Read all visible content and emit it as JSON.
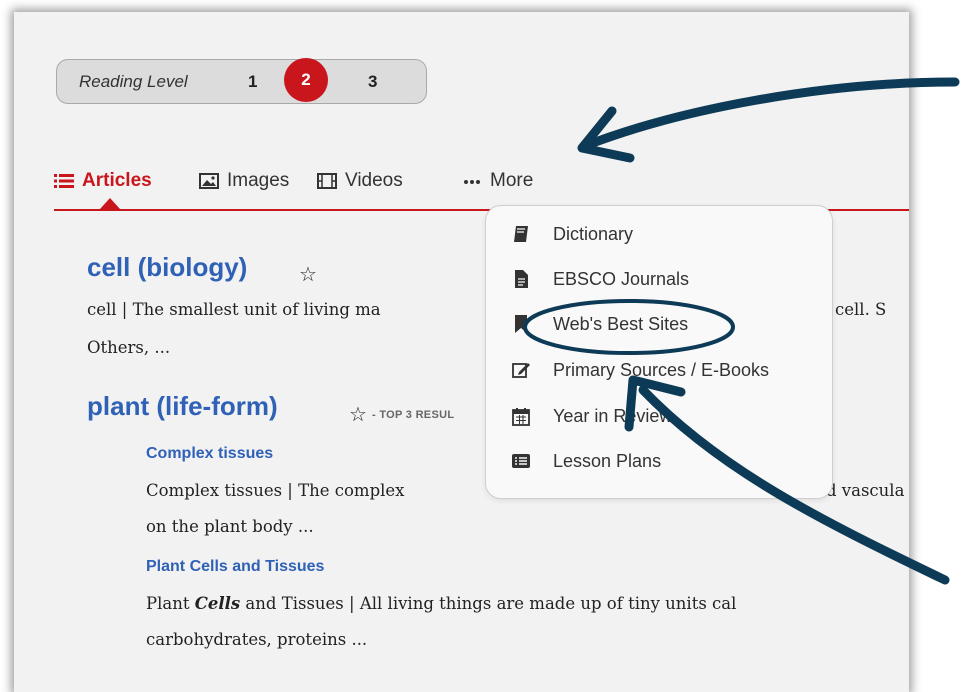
{
  "reading_level": {
    "label": "Reading Level",
    "levels": [
      "1",
      "2",
      "3"
    ],
    "active": "2"
  },
  "tabs": [
    {
      "label": "Articles",
      "icon": "list-icon",
      "active": true
    },
    {
      "label": "Images",
      "icon": "image-icon",
      "active": false
    },
    {
      "label": "Videos",
      "icon": "film-icon",
      "active": false
    },
    {
      "label": "More",
      "icon": "ellipsis-icon",
      "active": false
    }
  ],
  "results": [
    {
      "title": "cell (biology)",
      "snippet_line1": "cell  |  The smallest unit of living ma",
      "snippet_line1_tail": "e cell. S",
      "snippet_line2": "Others, ..."
    },
    {
      "title": "plant (life-form)",
      "badge": "- TOP 3 RESUL",
      "subresults": [
        {
          "title": "Complex tissues",
          "line1": "Complex tissues  | The complex ",
          "line1_tail": "d vascula",
          "line2": "on the plant body ..."
        },
        {
          "title": "Plant Cells and Tissues",
          "line1_a": "Plant ",
          "line1_em": "Cells",
          "line1_b": " and Tissues  | All living things are made up of tiny units cal",
          "line2": "carbohydrates, proteins ..."
        }
      ]
    }
  ],
  "more_menu": [
    {
      "label": "Dictionary",
      "icon": "book-icon"
    },
    {
      "label": "EBSCO Journals",
      "icon": "document-icon"
    },
    {
      "label": "Web's Best Sites",
      "icon": "bookmark-icon"
    },
    {
      "label": "Primary Sources / E-Books",
      "icon": "edit-icon"
    },
    {
      "label": "Year in Review",
      "icon": "calendar-icon"
    },
    {
      "label": "Lesson Plans",
      "icon": "list-box-icon"
    }
  ],
  "colors": {
    "accent_red": "#c9161d",
    "link_blue": "#2f61b6",
    "annotation_navy": "#0d3b57"
  }
}
